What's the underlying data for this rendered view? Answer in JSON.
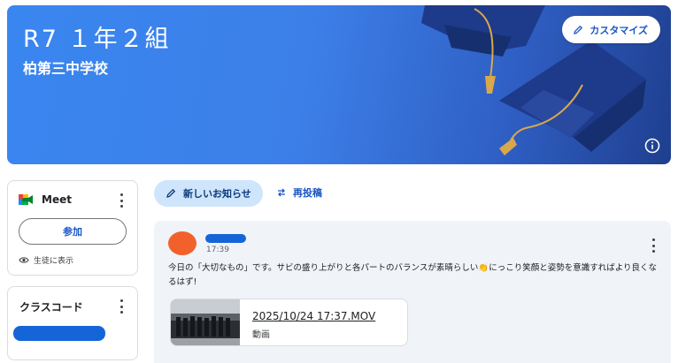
{
  "banner": {
    "title": "R7 １年２組",
    "subtitle": "柏第三中学校",
    "customize_label": "カスタマイズ"
  },
  "meet": {
    "title": "Meet",
    "join_label": "参加",
    "visibility_label": "生徒に表示"
  },
  "class_code": {
    "title": "クラスコード"
  },
  "actions": {
    "new_post_label": "新しいお知らせ",
    "repost_label": "再投稿"
  },
  "post": {
    "time": "17:39",
    "text": "今日の「大切なもの」です。サビの盛り上がりと各パートのバランスが素晴らしい👏にっこり笑顔と姿勢を意識すればより良くなるはず!",
    "attachment": {
      "title": "2025/10/24 17:37.MOV",
      "type": "動画"
    }
  },
  "colors": {
    "banner": "#3a86f0",
    "accent": "#1a56c4",
    "avatar": "#f2612c",
    "chip": "#cfe5fb"
  }
}
